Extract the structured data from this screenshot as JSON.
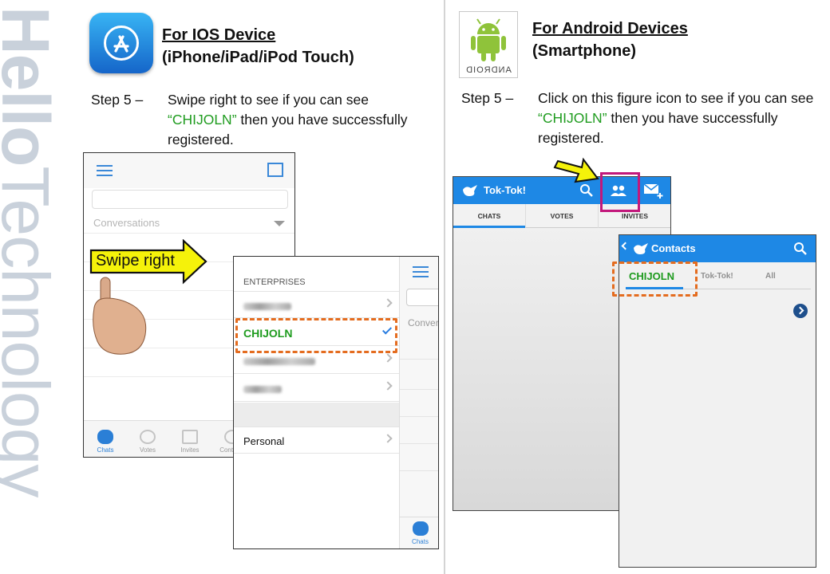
{
  "brand": {
    "hello": "Hello",
    "technology": "Technology"
  },
  "ios": {
    "heading_line1": "For IOS Device",
    "heading_line2": "(iPhone/iPad/iPod Touch)",
    "step_number": "Step 5 –",
    "step_text_before": "Swipe right to see if you can see ",
    "step_highlight": "“CHIJOLN”",
    "step_text_after": " then you have successfully registered.",
    "screen1": {
      "conversations_label": "Conversations",
      "tabs": [
        "Chats",
        "Votes",
        "Invites",
        "Contacts"
      ]
    },
    "swipe_label": "Swipe right",
    "screen2": {
      "section_label": "ENTERPRISES",
      "selected_item": "CHIJOLN",
      "personal_item": "Personal",
      "right_conv_label": "Conver",
      "right_tab_label": "Chats"
    }
  },
  "android": {
    "heading_line1": "For Android Devices",
    "heading_line2": "(Smartphone)",
    "icon_word": "ANDROID",
    "step_number": "Step 5 –",
    "step_text_before": "Click on this figure icon to see if you can see ",
    "step_highlight": "“CHIJOLN”",
    "step_text_after": " then you have successfully registered.",
    "screen1": {
      "app_title": "Tok-Tok!",
      "tabs": [
        "CHATS",
        "VOTES",
        "INVITES"
      ]
    },
    "screen2": {
      "title": "Contacts",
      "tabs": [
        "CHIJOLN",
        "Tok-Tok!",
        "All"
      ]
    }
  },
  "colors": {
    "accent_blue": "#1e88e5",
    "highlight_green": "#1f9c1f",
    "dashed_orange": "#e46c1f",
    "magenta": "#c2187b",
    "arrow_yellow": "#f5f20a"
  }
}
